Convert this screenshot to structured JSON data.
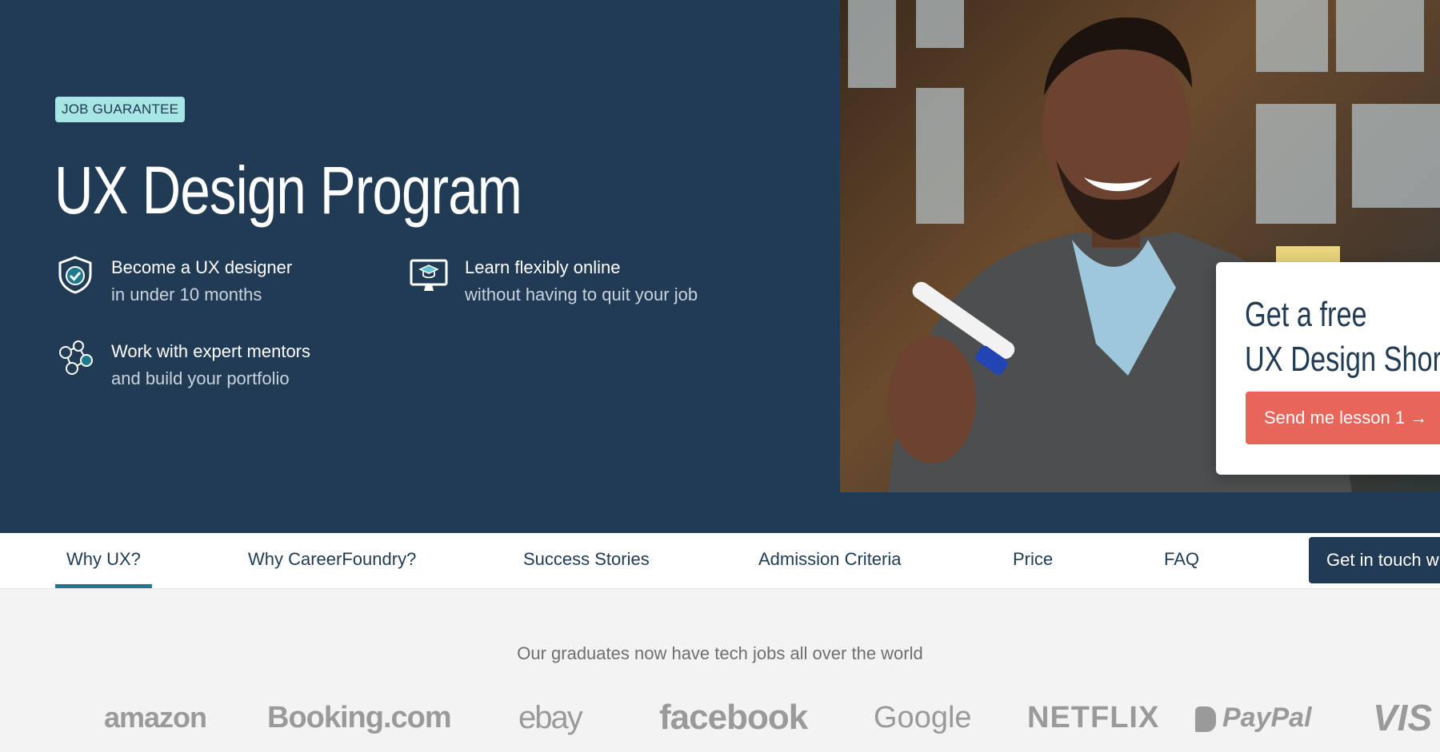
{
  "hero": {
    "badge": "JOB GUARANTEE",
    "title": "UX Design Program",
    "features": [
      {
        "icon": "shield-check-icon",
        "line1": "Become a UX designer",
        "line2": "in under 10 months"
      },
      {
        "icon": "monitor-graduation-icon",
        "line1": "Learn flexibly online",
        "line2": "without having to quit your job"
      },
      {
        "icon": "mentor-network-icon",
        "line1": "Work with expert mentors",
        "line2": "and build your portfolio"
      }
    ]
  },
  "card": {
    "title_line1": "Get a free",
    "title_line2": "UX Design Short C",
    "button": "Send me lesson 1 →"
  },
  "nav": {
    "items": [
      "Why UX?",
      "Why CareerFoundry?",
      "Success Stories",
      "Admission Criteria",
      "Price",
      "FAQ"
    ],
    "active": "Why UX?",
    "cta": "Get in touch w"
  },
  "graduates": {
    "heading": "Our graduates now have tech jobs all over the world",
    "logos": [
      "amazon",
      "Booking.com",
      "ebay",
      "facebook",
      "Google",
      "NETFLIX",
      "PayPal",
      "VIS"
    ]
  },
  "colors": {
    "hero_bg": "#223b54",
    "badge_bg": "#a8e6e6",
    "accent_teal": "#1d7a8c",
    "cta_red": "#e8655a"
  }
}
